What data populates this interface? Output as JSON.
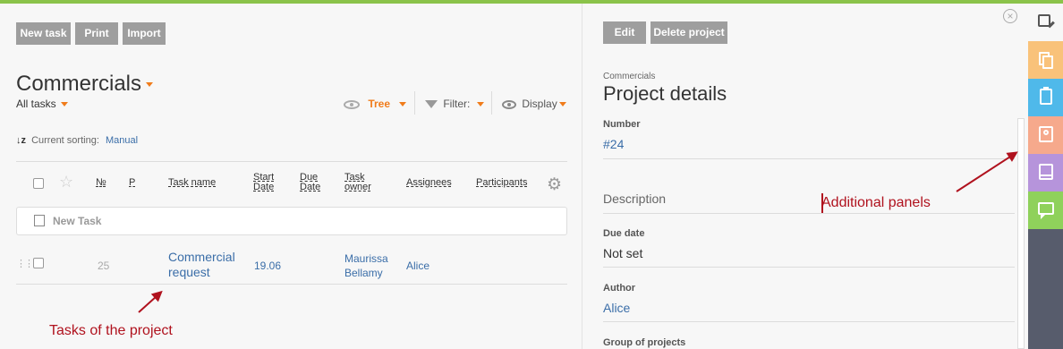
{
  "toolbar": {
    "new_task": "New task",
    "print": "Print",
    "import": "Import"
  },
  "project": {
    "title": "Commercials",
    "filter_all": "All tasks"
  },
  "view": {
    "tree": "Tree",
    "filter": "Filter:",
    "display": "Display"
  },
  "sorting": {
    "label": "Current sorting:",
    "value": "Manual"
  },
  "columns": {
    "num": "№",
    "p": "P",
    "name": "Task name",
    "start": "Start Date",
    "due": "Due Date",
    "owner": "Task owner",
    "assignees": "Assignees",
    "participants": "Participants"
  },
  "new_task_row": "New Task",
  "tasks": [
    {
      "num": "25",
      "name": "Commercial request",
      "start": "19.06",
      "owner": "Maurissa Bellamy",
      "assignee": "Alice"
    }
  ],
  "details": {
    "edit": "Edit",
    "delete": "Delete project",
    "breadcrumb": "Commercials",
    "title": "Project details",
    "number_label": "Number",
    "number_value": "#24",
    "description_label": "Description",
    "due_label": "Due date",
    "due_value": "Not set",
    "author_label": "Author",
    "author_value": "Alice",
    "group_label": "Group of projects"
  },
  "annotations": {
    "tasks": "Tasks of the project",
    "panels": "Additional panels"
  },
  "panels": [
    {
      "name": "documents",
      "color": "#f9c27a"
    },
    {
      "name": "clipboard",
      "color": "#4fb9ea"
    },
    {
      "name": "contact-card",
      "color": "#f6a98c"
    },
    {
      "name": "inbox",
      "color": "#b694db"
    },
    {
      "name": "chat",
      "color": "#8fd15b"
    }
  ],
  "colors": {
    "accent": "#f07c1b",
    "link": "#3b6ea8",
    "annotation": "#b0121e",
    "sidebar": "#575c6c"
  }
}
